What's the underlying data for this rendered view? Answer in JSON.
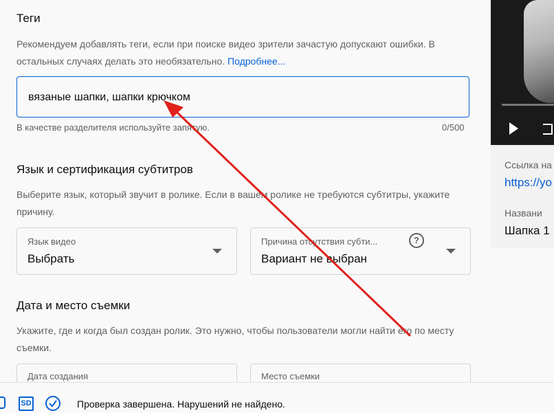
{
  "tags": {
    "title": "Теги",
    "description": "Рекомендуем добавлять теги, если при поиске видео зрители зачастую допускают ошибки. В остальных случаях делать это необязательно.",
    "more_link": "Подробнее...",
    "value": "вязаные шапки, шапки крючком",
    "hint": "В качестве разделителя используйте запятую.",
    "counter": "0/500"
  },
  "subtitles": {
    "title": "Язык и сертификация субтитров",
    "description": "Выберите язык, который звучит в ролике. Если в вашем ролике не требуются субтитры, укажите причину.",
    "language": {
      "label": "Язык видео",
      "value": "Выбрать"
    },
    "reason": {
      "label": "Причина отсутствия субти...",
      "value": "Вариант не выбран"
    }
  },
  "location": {
    "title": "Дата и место съемки",
    "description": "Укажите, где и когда был создан ролик. Это нужно, чтобы пользователи могли найти его по месту съемки.",
    "date_label": "Дата создания",
    "place_label": "Место съемки"
  },
  "footer": {
    "sd_badge": "SD",
    "status": "Проверка завершена. Нарушений не найдено."
  },
  "side": {
    "link_label": "Ссылка на",
    "link_value": "https://yo",
    "name_label": "Названи",
    "name_value": "Шапка 1"
  },
  "colors": {
    "accent": "#065fd4",
    "annotation_arrow": "#e0201b"
  }
}
